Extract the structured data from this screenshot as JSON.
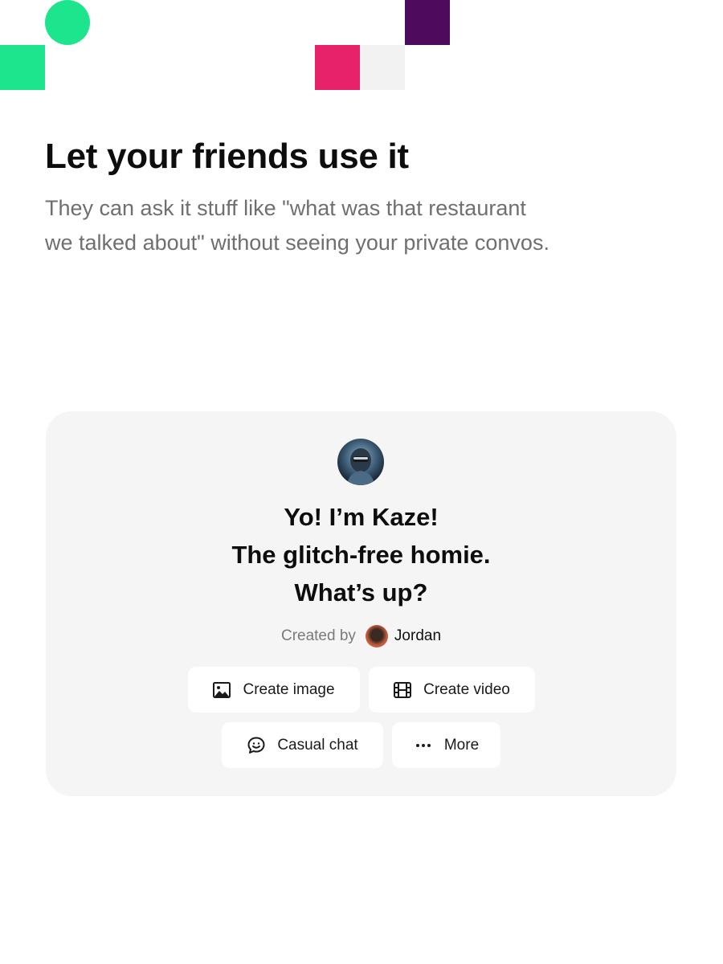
{
  "colors": {
    "green": "#1de58d",
    "pink": "#e8216b",
    "purple": "#4e0a5c",
    "light_grey": "#f2f2f2",
    "card_bg": "#f5f5f5",
    "subtext": "#6f6f6f"
  },
  "hero": {
    "title": "Let your friends use it",
    "subtitle_lines": [
      "They can ask it stuff like \"what was that restaurant",
      "we talked about\" without seeing your private convos."
    ]
  },
  "card": {
    "avatar_icon": "bot-avatar",
    "greeting_lines": [
      "Yo! I’m Kaze!",
      "The glitch-free homie.",
      "What’s up?"
    ],
    "created_by_label": "Created by",
    "creator_name": "Jordan",
    "creator_avatar_icon": "user-avatar",
    "actions": [
      {
        "label": "Create image",
        "icon": "image-icon"
      },
      {
        "label": "Create video",
        "icon": "film-icon"
      },
      {
        "label": "Casual chat",
        "icon": "chat-smile-icon"
      },
      {
        "label": "More",
        "icon": "more-dots-icon"
      }
    ]
  }
}
